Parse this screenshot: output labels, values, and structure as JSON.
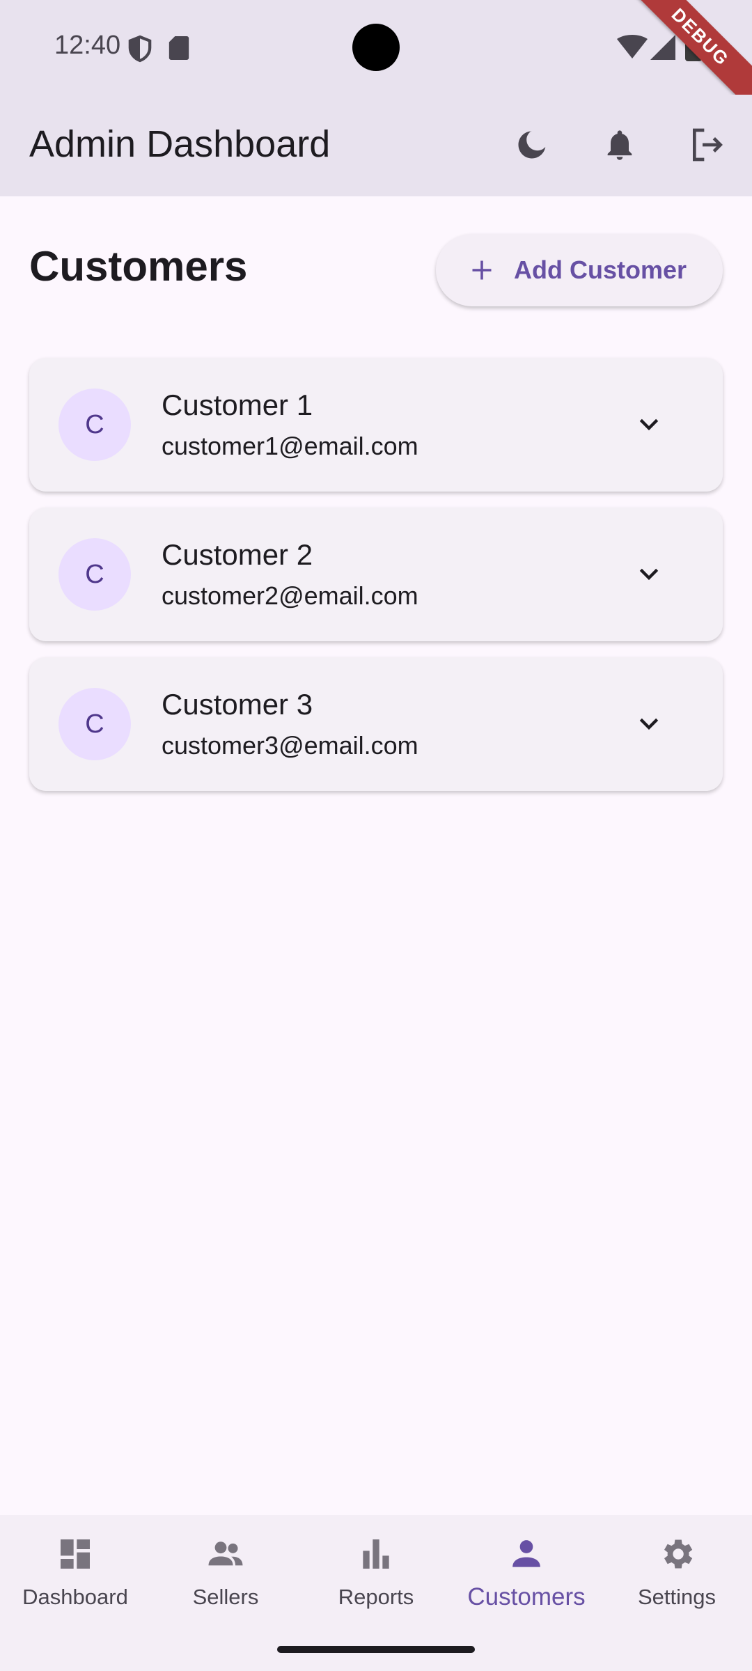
{
  "status_bar": {
    "time": "12:40",
    "icons": [
      "shield-icon",
      "sd-card-icon",
      "wifi-icon",
      "signal-icon",
      "battery-icon"
    ],
    "debug_banner": "DEBUG"
  },
  "app_bar": {
    "title": "Admin Dashboard",
    "actions": [
      "dark-mode-icon",
      "notifications-icon",
      "logout-icon"
    ]
  },
  "page": {
    "title": "Customers",
    "add_button_label": "Add Customer"
  },
  "customers": [
    {
      "initial": "C",
      "name": "Customer 1",
      "email": "customer1@email.com"
    },
    {
      "initial": "C",
      "name": "Customer 2",
      "email": "customer2@email.com"
    },
    {
      "initial": "C",
      "name": "Customer 3",
      "email": "customer3@email.com"
    }
  ],
  "bottom_nav": {
    "items": [
      {
        "label": "Dashboard",
        "icon": "dashboard-icon"
      },
      {
        "label": "Sellers",
        "icon": "people-icon"
      },
      {
        "label": "Reports",
        "icon": "bar-chart-icon"
      },
      {
        "label": "Customers",
        "icon": "person-icon"
      },
      {
        "label": "Settings",
        "icon": "gear-icon"
      }
    ],
    "active": "Customers"
  },
  "colors": {
    "primary": "#6750A4",
    "app_bar_bg": "#E8E2EE",
    "page_bg": "#FDF7FE",
    "avatar_bg": "#EADDFF",
    "debug_ribbon": "#B03A3A"
  }
}
